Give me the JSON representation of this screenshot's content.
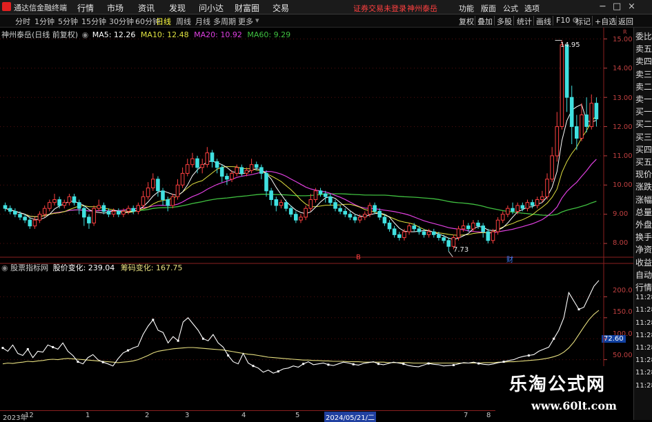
{
  "menubar": {
    "app_title": "通达信金融终端",
    "menus": [
      "行情",
      "市场",
      "资讯",
      "发现",
      "问小达",
      "财富圈",
      "交易"
    ],
    "notice": "证券交易未登录",
    "stock_link": "神州泰岳",
    "right_items": [
      "功能",
      "版面",
      "公式",
      "选项"
    ],
    "window_controls": [
      "−",
      "□",
      "×"
    ]
  },
  "timeframes": {
    "items": [
      "分时",
      "1分钟",
      "5分钟",
      "15分钟",
      "30分钟",
      "60分钟",
      "日线",
      "周线",
      "月线",
      "多周期",
      "更多"
    ],
    "active": "日线"
  },
  "toolbar": {
    "items": [
      "复权",
      "叠加",
      "多股",
      "统计",
      "画线",
      "F10",
      "标记",
      "+自选",
      "返回"
    ]
  },
  "main_legend": {
    "title": "神州泰岳(日线 前复权)",
    "ma5": "MA5: 12.26",
    "ma10": "MA10: 12.48",
    "ma20": "MA20: 10.92",
    "ma60": "MA60: 9.29"
  },
  "main_axis": {
    "ticks": [
      "15.00",
      "14.00",
      "13.00",
      "12.00",
      "11.00",
      "10.00",
      "9.00",
      "8.00"
    ],
    "unit_label": "R",
    "high_label": "14.95",
    "low_label": "7.73",
    "event_label_1": "B",
    "event_label_2": "财"
  },
  "sub_legend": {
    "title": "股票指标网",
    "line1": "股价变化: 239.04",
    "line2": "筹码变化: 167.75"
  },
  "sub_axis": {
    "ticks": [
      "200.0",
      "150.0",
      "100.0",
      "50.00"
    ],
    "current_value": "72.60"
  },
  "x_axis": {
    "labels": [
      "2023年",
      "12",
      "1",
      "2",
      "3",
      "4",
      "5",
      "2024/05/21/二",
      "7",
      "8"
    ]
  },
  "right_panel": {
    "items": [
      "委比",
      "卖五",
      "卖四",
      "卖三",
      "卖二",
      "卖一",
      "买一",
      "买二",
      "买三",
      "买四",
      "买五",
      "现价",
      "涨跌",
      "涨幅",
      "总量",
      "外盘",
      "换手",
      "净资",
      "收益",
      "自动",
      "行情",
      "11:28",
      "11:28",
      "11:28",
      "11:28",
      "11:28",
      "11:28",
      "11:28",
      "11:28"
    ]
  },
  "watermark": {
    "title": "乐淘公式网",
    "url": "www.60lt.com"
  },
  "colors": {
    "up": "#ff4040",
    "down": "#40e0e0",
    "ma5": "#ffffff",
    "ma10": "#e0e040",
    "ma20": "#e040e0",
    "ma60": "#40c040",
    "line_white": "#ffffff",
    "line_yellow": "#e8e080",
    "axis_red": "#c04040"
  },
  "chart_data": {
    "type": "candlestick",
    "price_range": [
      7.6,
      15.2
    ],
    "candles": [
      [
        9.3,
        9.2,
        9.4,
        9.1
      ],
      [
        9.2,
        9.1,
        9.3,
        9.0
      ],
      [
        9.1,
        9.0,
        9.2,
        8.9
      ],
      [
        9.0,
        8.9,
        9.1,
        8.8
      ],
      [
        8.9,
        8.8,
        9.0,
        8.7
      ],
      [
        8.8,
        8.6,
        8.9,
        8.5
      ],
      [
        8.6,
        8.8,
        8.9,
        8.5
      ],
      [
        8.8,
        9.0,
        9.1,
        8.7
      ],
      [
        9.0,
        9.2,
        9.3,
        8.9
      ],
      [
        9.2,
        9.4,
        9.5,
        9.1
      ],
      [
        9.4,
        9.5,
        9.7,
        9.3
      ],
      [
        9.5,
        9.3,
        9.6,
        9.2
      ],
      [
        9.3,
        9.4,
        9.5,
        9.2
      ],
      [
        9.4,
        9.6,
        9.7,
        9.3
      ],
      [
        9.6,
        9.4,
        9.7,
        9.3
      ],
      [
        9.4,
        9.2,
        9.5,
        9.0
      ],
      [
        9.2,
        8.9,
        9.3,
        8.6
      ],
      [
        8.9,
        8.7,
        9.0,
        8.5
      ],
      [
        8.7,
        9.2,
        9.3,
        8.6
      ],
      [
        9.2,
        9.3,
        9.5,
        9.1
      ],
      [
        9.3,
        9.1,
        9.4,
        9.0
      ],
      [
        9.1,
        9.0,
        9.2,
        8.9
      ],
      [
        9.0,
        9.1,
        9.2,
        8.9
      ],
      [
        9.1,
        9.0,
        9.2,
        8.9
      ],
      [
        9.0,
        9.1,
        9.2,
        8.9
      ],
      [
        9.1,
        9.2,
        9.3,
        9.0
      ],
      [
        9.2,
        9.1,
        9.3,
        9.0
      ],
      [
        9.1,
        9.3,
        9.4,
        9.0
      ],
      [
        9.3,
        9.6,
        9.8,
        9.2
      ],
      [
        9.6,
        9.9,
        10.1,
        9.5
      ],
      [
        9.9,
        10.2,
        10.4,
        9.8
      ],
      [
        10.2,
        9.8,
        10.3,
        9.6
      ],
      [
        9.8,
        9.5,
        9.9,
        9.3
      ],
      [
        9.5,
        9.3,
        9.6,
        9.1
      ],
      [
        9.3,
        9.6,
        9.7,
        9.2
      ],
      [
        9.6,
        10.0,
        10.2,
        9.5
      ],
      [
        10.0,
        10.4,
        10.6,
        9.9
      ],
      [
        10.4,
        10.7,
        10.9,
        10.3
      ],
      [
        10.7,
        10.9,
        11.1,
        10.6
      ],
      [
        10.9,
        10.6,
        11.0,
        10.4
      ],
      [
        10.6,
        10.7,
        10.9,
        10.4
      ],
      [
        10.7,
        11.1,
        11.3,
        10.6
      ],
      [
        11.1,
        10.8,
        11.2,
        10.6
      ],
      [
        10.8,
        10.6,
        10.9,
        10.4
      ],
      [
        10.6,
        10.3,
        10.7,
        10.1
      ],
      [
        10.3,
        10.2,
        10.4,
        10.0
      ],
      [
        10.2,
        10.4,
        10.5,
        10.1
      ],
      [
        10.4,
        10.6,
        10.7,
        10.3
      ],
      [
        10.6,
        10.4,
        10.7,
        10.3
      ],
      [
        10.4,
        10.5,
        10.6,
        10.3
      ],
      [
        10.5,
        10.7,
        10.9,
        10.4
      ],
      [
        10.7,
        10.6,
        10.8,
        10.5
      ],
      [
        10.6,
        10.4,
        10.7,
        10.2
      ],
      [
        10.4,
        9.8,
        10.5,
        9.6
      ],
      [
        9.8,
        9.5,
        9.9,
        9.3
      ],
      [
        9.5,
        9.3,
        9.6,
        9.1
      ],
      [
        9.3,
        9.4,
        9.5,
        9.2
      ],
      [
        9.4,
        9.2,
        9.5,
        9.1
      ],
      [
        9.2,
        9.0,
        9.3,
        8.9
      ],
      [
        9.0,
        8.8,
        9.1,
        8.7
      ],
      [
        8.8,
        8.9,
        9.0,
        8.7
      ],
      [
        8.9,
        9.2,
        9.3,
        8.8
      ],
      [
        9.2,
        9.5,
        9.7,
        9.1
      ],
      [
        9.5,
        9.8,
        9.9,
        9.4
      ],
      [
        9.8,
        9.7,
        9.9,
        9.6
      ],
      [
        9.7,
        9.6,
        9.8,
        9.4
      ],
      [
        9.6,
        9.4,
        9.7,
        9.3
      ],
      [
        9.4,
        9.2,
        9.5,
        9.1
      ],
      [
        9.2,
        9.1,
        9.3,
        9.0
      ],
      [
        9.1,
        9.0,
        9.2,
        8.9
      ],
      [
        9.0,
        8.9,
        9.1,
        8.8
      ],
      [
        8.9,
        8.8,
        9.0,
        8.7
      ],
      [
        8.8,
        8.9,
        9.0,
        8.7
      ],
      [
        8.9,
        9.0,
        9.1,
        8.8
      ],
      [
        9.0,
        9.3,
        9.4,
        8.9
      ],
      [
        9.3,
        9.1,
        9.4,
        9.0
      ],
      [
        9.1,
        8.9,
        9.2,
        8.8
      ],
      [
        8.9,
        8.7,
        9.0,
        8.6
      ],
      [
        8.7,
        8.5,
        8.8,
        8.4
      ],
      [
        8.5,
        8.3,
        8.6,
        8.2
      ],
      [
        8.3,
        8.2,
        8.4,
        8.1
      ],
      [
        8.2,
        8.4,
        8.5,
        8.1
      ],
      [
        8.4,
        8.6,
        8.7,
        8.3
      ],
      [
        8.6,
        8.5,
        8.7,
        8.4
      ],
      [
        8.5,
        8.4,
        8.6,
        8.3
      ],
      [
        8.4,
        8.3,
        8.5,
        8.2
      ],
      [
        8.3,
        8.4,
        8.5,
        8.2
      ],
      [
        8.4,
        8.3,
        8.5,
        8.2
      ],
      [
        8.3,
        8.2,
        8.4,
        8.1
      ],
      [
        8.2,
        8.1,
        8.3,
        8.0
      ],
      [
        8.1,
        7.9,
        8.2,
        7.73
      ],
      [
        7.9,
        8.2,
        8.3,
        7.8
      ],
      [
        8.2,
        8.5,
        8.6,
        8.1
      ],
      [
        8.5,
        8.6,
        8.8,
        8.4
      ],
      [
        8.6,
        8.5,
        8.7,
        8.4
      ],
      [
        8.5,
        8.7,
        8.8,
        8.4
      ],
      [
        8.7,
        8.6,
        8.8,
        8.5
      ],
      [
        8.6,
        8.4,
        8.7,
        8.2
      ],
      [
        8.4,
        8.1,
        8.5,
        8.0
      ],
      [
        8.1,
        8.4,
        8.5,
        8.0
      ],
      [
        8.4,
        8.8,
        8.9,
        8.3
      ],
      [
        8.8,
        9.0,
        9.1,
        8.7
      ],
      [
        9.0,
        9.2,
        9.3,
        8.9
      ],
      [
        9.2,
        9.1,
        9.4,
        9.0
      ],
      [
        9.1,
        9.3,
        9.4,
        9.0
      ],
      [
        9.3,
        9.2,
        9.4,
        9.1
      ],
      [
        9.2,
        9.4,
        9.5,
        9.1
      ],
      [
        9.4,
        9.3,
        9.5,
        9.2
      ],
      [
        9.3,
        9.5,
        9.6,
        9.2
      ],
      [
        9.5,
        9.6,
        9.8,
        9.4
      ],
      [
        9.6,
        10.2,
        10.4,
        9.5
      ],
      [
        10.2,
        11.0,
        11.3,
        10.1
      ],
      [
        11.0,
        12.0,
        12.5,
        10.8
      ],
      [
        12.0,
        14.8,
        14.95,
        11.9
      ],
      [
        14.8,
        13.0,
        14.2,
        12.5
      ],
      [
        13.0,
        12.0,
        13.4,
        11.4
      ],
      [
        12.0,
        11.6,
        12.4,
        11.2
      ],
      [
        11.6,
        12.4,
        12.8,
        11.5
      ],
      [
        12.4,
        12.0,
        13.0,
        11.8
      ],
      [
        12.0,
        12.8,
        13.1,
        11.9
      ],
      [
        12.8,
        12.26,
        13.0,
        12.0
      ]
    ],
    "sub_range": [
      0,
      250
    ],
    "price_change_line": [
      78,
      70,
      85,
      65,
      60,
      75,
      55,
      70,
      68,
      85,
      80,
      75,
      90,
      70,
      60,
      45,
      40,
      55,
      62,
      50,
      44,
      40,
      35,
      52,
      66,
      72,
      78,
      82,
      110,
      130,
      145,
      120,
      115,
      90,
      105,
      95,
      140,
      150,
      135,
      120,
      100,
      95,
      110,
      90,
      80,
      60,
      45,
      40,
      65,
      42,
      35,
      30,
      20,
      25,
      18,
      22,
      28,
      30,
      35,
      32,
      40,
      45,
      38,
      40,
      42,
      38,
      36,
      40,
      44,
      42,
      39,
      37,
      41,
      43,
      45,
      40,
      38,
      41,
      44,
      42,
      40,
      36,
      34,
      33,
      37,
      41,
      39,
      38,
      35,
      36,
      37,
      40,
      43,
      42,
      44,
      41,
      39,
      38,
      40,
      43,
      45,
      48,
      50,
      55,
      58,
      60,
      62,
      70,
      75,
      80,
      100,
      120,
      150,
      210,
      190,
      170,
      175,
      200,
      225,
      239.04
    ],
    "chip_change_line": [
      40,
      42,
      41,
      43,
      44,
      46,
      45,
      47,
      48,
      50,
      51,
      50,
      52,
      53,
      52,
      51,
      50,
      49,
      48,
      47,
      46,
      45,
      44,
      43,
      44,
      45,
      47,
      50,
      55,
      60,
      66,
      70,
      72,
      74,
      76,
      77,
      78,
      79,
      79,
      78,
      77,
      76,
      75,
      74,
      73,
      71,
      69,
      67,
      65,
      63,
      62,
      60,
      58,
      56,
      55,
      54,
      53,
      52,
      51,
      50,
      49,
      49,
      48,
      48,
      47,
      47,
      46,
      46,
      46,
      45,
      45,
      45,
      44,
      44,
      44,
      44,
      44,
      43,
      43,
      43,
      43,
      43,
      42,
      42,
      42,
      42,
      42,
      42,
      42,
      42,
      42,
      42,
      42,
      42,
      42,
      42,
      43,
      43,
      43,
      44,
      44,
      45,
      45,
      46,
      47,
      48,
      49,
      50,
      52,
      54,
      57,
      61,
      68,
      78,
      92,
      110,
      128,
      145,
      158,
      167.75
    ]
  }
}
